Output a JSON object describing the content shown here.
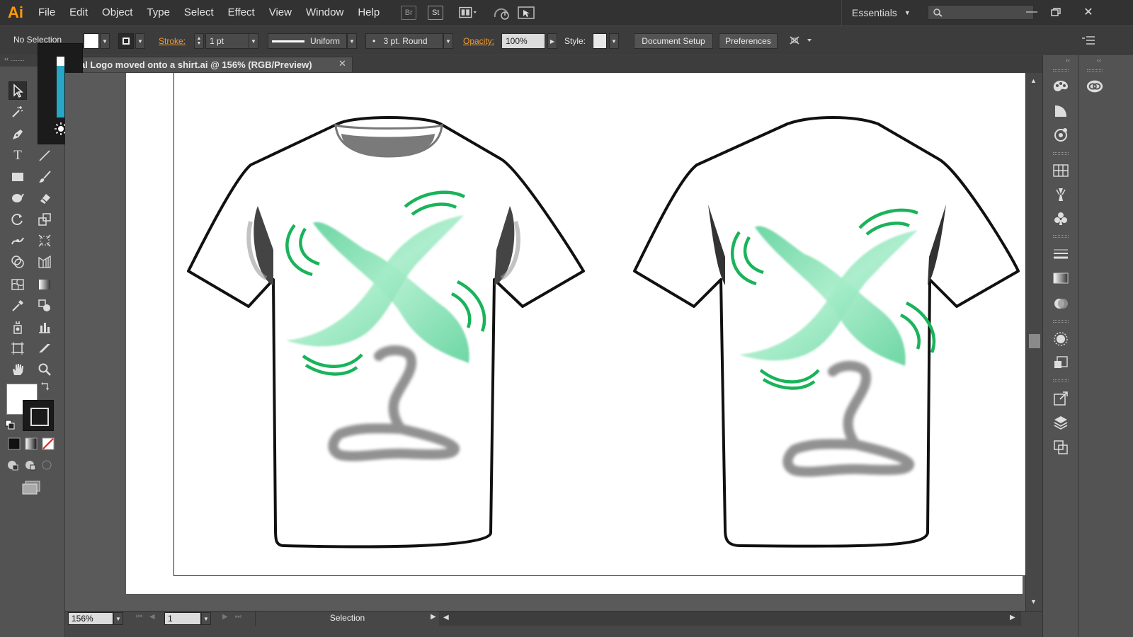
{
  "app": {
    "logo": "Ai",
    "menu": [
      "File",
      "Edit",
      "Object",
      "Type",
      "Select",
      "Effect",
      "View",
      "Window",
      "Help"
    ],
    "bridge_label": "Br",
    "stock_label": "St",
    "workspace": "Essentials",
    "search_placeholder": ""
  },
  "control_bar": {
    "selection_label": "No Selection",
    "stroke_label": "Stroke:",
    "stroke_weight": "1 pt",
    "profile": "Uniform",
    "brush": "3 pt. Round",
    "opacity_label": "Opacity:",
    "opacity": "100%",
    "style_label": "Style:",
    "document_setup": "Document Setup",
    "preferences": "Preferences"
  },
  "document": {
    "tab_title": "Final Logo moved onto a shirt.ai @ 156% (RGB/Preview)",
    "visible_tab_title": "nal Logo moved onto a shirt.ai @ 156% (RGB/Preview)"
  },
  "status_bar": {
    "zoom": "156%",
    "artboard_number": "1",
    "tool_status": "Selection"
  },
  "brightness": {
    "level_fraction": 0.85
  },
  "colors": {
    "accent_orange": "#ff9a00",
    "logo_green": "#19b35a",
    "logo_mint": "#6fdca8"
  }
}
